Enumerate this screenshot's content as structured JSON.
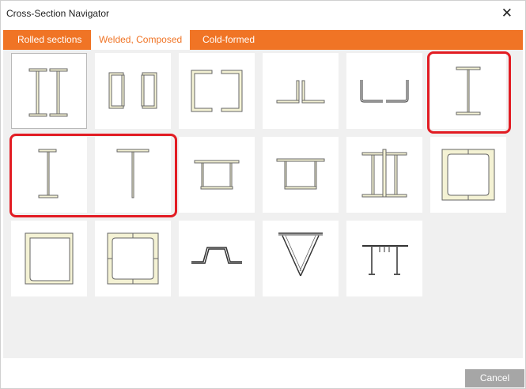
{
  "window": {
    "title": "Cross-Section Navigator",
    "close_symbol": "✕"
  },
  "tabs": [
    {
      "label": "Rolled sections",
      "active": false
    },
    {
      "label": "Welded, Composed",
      "active": true
    },
    {
      "label": "Cold-formed",
      "active": false
    }
  ],
  "footer": {
    "cancel_label": "Cancel"
  },
  "colors": {
    "accent": "#f07425",
    "highlight": "#e21c23",
    "cancel_bg": "#a6a6a6"
  },
  "icons": [
    "double-i-section-icon",
    "double-channel-back-to-back-icon",
    "double-channel-boxed-icon",
    "double-angle-icon",
    "double-cold-angle-icon",
    "welded-i-section-icon",
    "welded-i-asymmetric-icon",
    "welded-tee-section-icon",
    "box-flange-plates-icon",
    "box-top-plate-icon",
    "triple-i-section-icon",
    "box-channels-icon",
    "box-angles-icon",
    "box-four-channels-icon",
    "hat-section-icon",
    "triangle-truss-icon",
    "slab-beam-icon"
  ]
}
